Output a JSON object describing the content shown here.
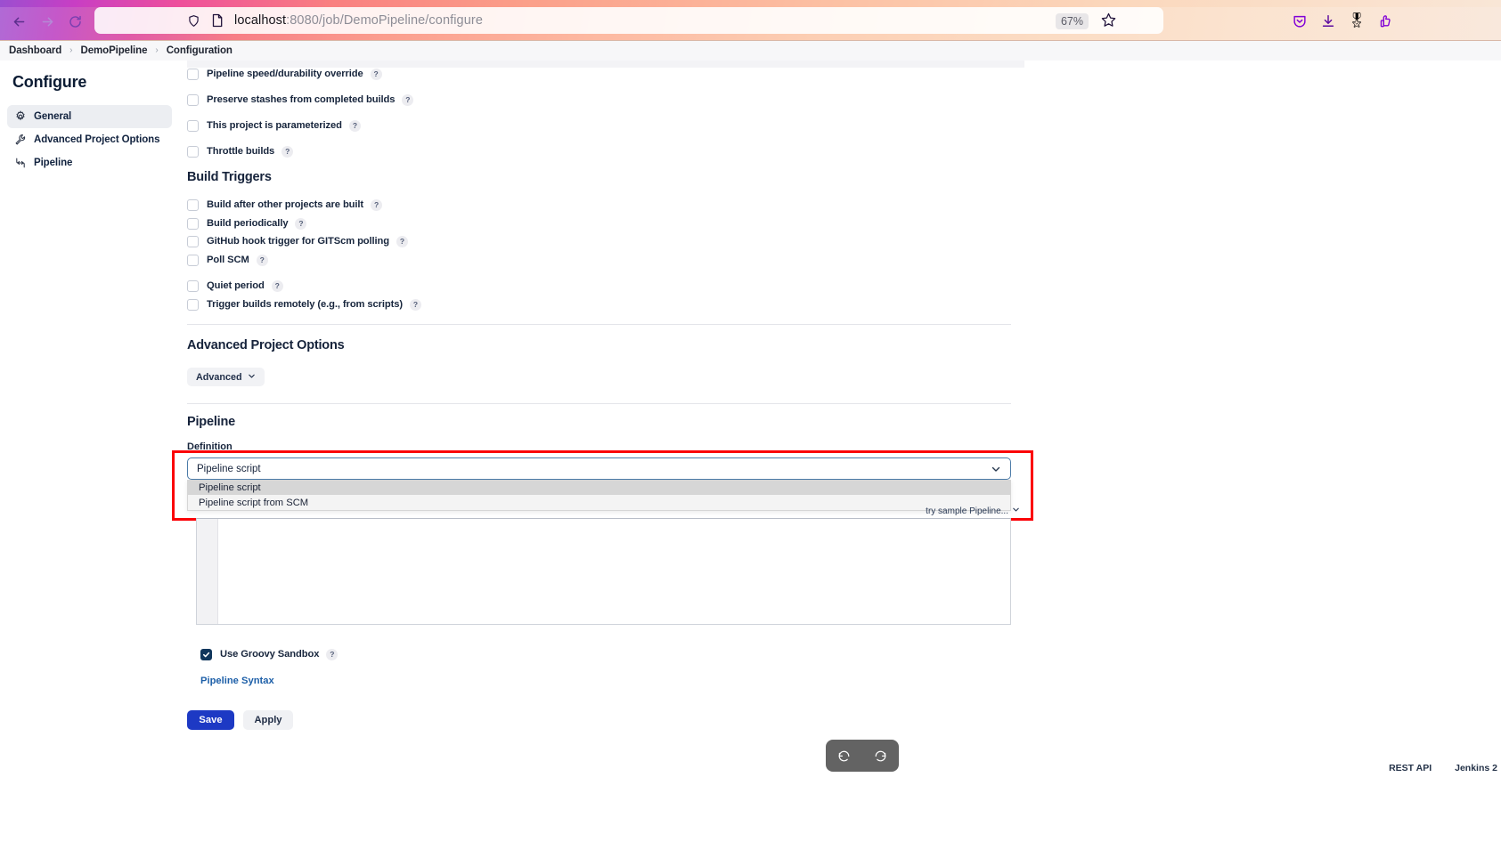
{
  "browser": {
    "url_host": "localhost",
    "url_path": ":8080/job/DemoPipeline/configure",
    "zoom_level": "67%",
    "icons": {
      "back": "back-arrow-icon",
      "forward": "forward-arrow-icon",
      "reload": "reload-icon",
      "shield": "tracking-protection-shield-icon",
      "page": "page-document-icon",
      "bookmark": "bookmark-star-icon",
      "pocket": "pocket-save-icon",
      "download": "download-arrow-icon",
      "extension": "extension-icon",
      "account": "account-profile-icon"
    }
  },
  "breadcrumb": {
    "items": [
      "Dashboard",
      "DemoPipeline",
      "Configuration"
    ],
    "separator": "›"
  },
  "sidebar": {
    "title": "Configure",
    "items": [
      {
        "label": "General",
        "icon": "gear-icon",
        "active": true
      },
      {
        "label": "Advanced Project Options",
        "icon": "wrench-icon",
        "active": false
      },
      {
        "label": "Pipeline",
        "icon": "pipeline-icon",
        "active": false
      }
    ]
  },
  "form": {
    "general_checkboxes": [
      {
        "label": "Pipeline speed/durability override",
        "checked": false,
        "help": "?"
      },
      {
        "label": "Preserve stashes from completed builds",
        "checked": false,
        "help": "?"
      },
      {
        "label": "This project is parameterized",
        "checked": false,
        "help": "?"
      },
      {
        "label": "Throttle builds",
        "checked": false,
        "help": "?"
      }
    ],
    "build_triggers": {
      "heading": "Build Triggers",
      "checkboxes": [
        {
          "label": "Build after other projects are built",
          "checked": false,
          "help": "?"
        },
        {
          "label": "Build periodically",
          "checked": false,
          "help": "?"
        },
        {
          "label": "GitHub hook trigger for GITScm polling",
          "checked": false,
          "help": "?"
        },
        {
          "label": "Poll SCM",
          "checked": false,
          "help": "?"
        },
        {
          "label": "Quiet period",
          "checked": false,
          "help": "?"
        },
        {
          "label": "Trigger builds remotely (e.g., from scripts)",
          "checked": false,
          "help": "?"
        }
      ]
    },
    "advanced_project_options": {
      "heading": "Advanced Project Options",
      "advanced_button": "Advanced",
      "advanced_caret": "chevron-down-icon"
    },
    "pipeline": {
      "heading": "Pipeline",
      "definition_label": "Definition",
      "definition_selected": "Pipeline script",
      "definition_options": [
        {
          "label": "Pipeline script",
          "highlighted": true
        },
        {
          "label": "Pipeline script from SCM",
          "highlighted": false
        }
      ],
      "sample_link": "try sample Pipeline...",
      "sample_caret": "chevron-down-icon",
      "script_value": "",
      "groovy_sandbox": {
        "label": "Use Groovy Sandbox",
        "checked": true,
        "help": "?"
      },
      "pipeline_syntax_link": "Pipeline Syntax"
    },
    "buttons": {
      "save": "Save",
      "apply": "Apply"
    }
  },
  "float_toolbar": {
    "undo": "undo-icon",
    "redo": "redo-icon"
  },
  "footer": {
    "rest_api": "REST API",
    "version": "Jenkins 2"
  },
  "colors": {
    "accent_blue": "#1d39c4",
    "highlight_red": "#fb0007",
    "link_blue": "#1d5fa8",
    "checkbox_checked": "#10365c"
  }
}
